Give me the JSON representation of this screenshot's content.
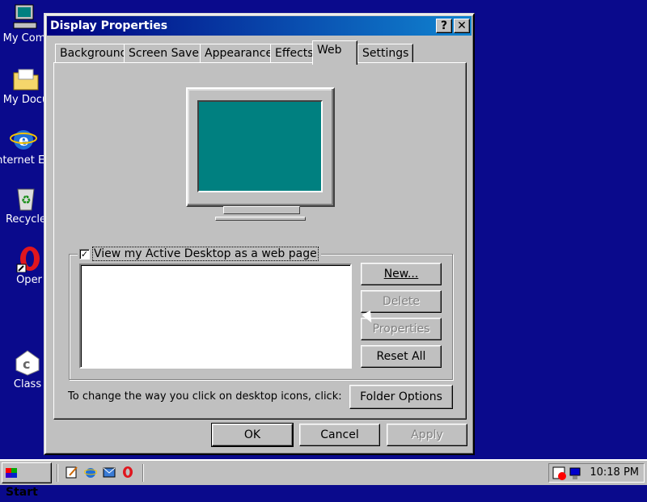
{
  "desktop": {
    "icons": [
      {
        "label": "My Com",
        "icon": "computer-icon"
      },
      {
        "label": "My Docu",
        "icon": "folder-icon"
      },
      {
        "label": "nternet Ex",
        "icon": "internet-explorer-icon"
      },
      {
        "label": "Recycle",
        "icon": "recycle-bin-icon"
      },
      {
        "label": "Oper",
        "icon": "opera-icon"
      },
      {
        "label": "Class",
        "icon": "class-icon"
      }
    ]
  },
  "dialog": {
    "title": "Display Properties",
    "help_label": "?",
    "close_label": "✕",
    "tabs": [
      {
        "label": "Background"
      },
      {
        "label": "Screen Saver"
      },
      {
        "label": "Appearance"
      },
      {
        "label": "Effects"
      },
      {
        "label": "Web"
      },
      {
        "label": "Settings"
      }
    ],
    "active_tab": "Web",
    "active_desktop": {
      "checkbox_label": "View my Active Desktop as a web page",
      "checked": true,
      "check_mark": "✓"
    },
    "side_buttons": {
      "new": "New...",
      "delete": "Delete",
      "properties": "Properties",
      "reset_all": "Reset All"
    },
    "hint_text": "To change the way you click on desktop icons, click:",
    "folder_options": "Folder Options",
    "ok": "OK",
    "cancel": "Cancel",
    "apply": "Apply"
  },
  "taskbar": {
    "start_label": "Start",
    "clock": "10:18 PM"
  },
  "colors": {
    "desktop": "#0a0a8c",
    "title_bar": "#000080",
    "screen": "#008080",
    "face": "#c0c0c0"
  }
}
